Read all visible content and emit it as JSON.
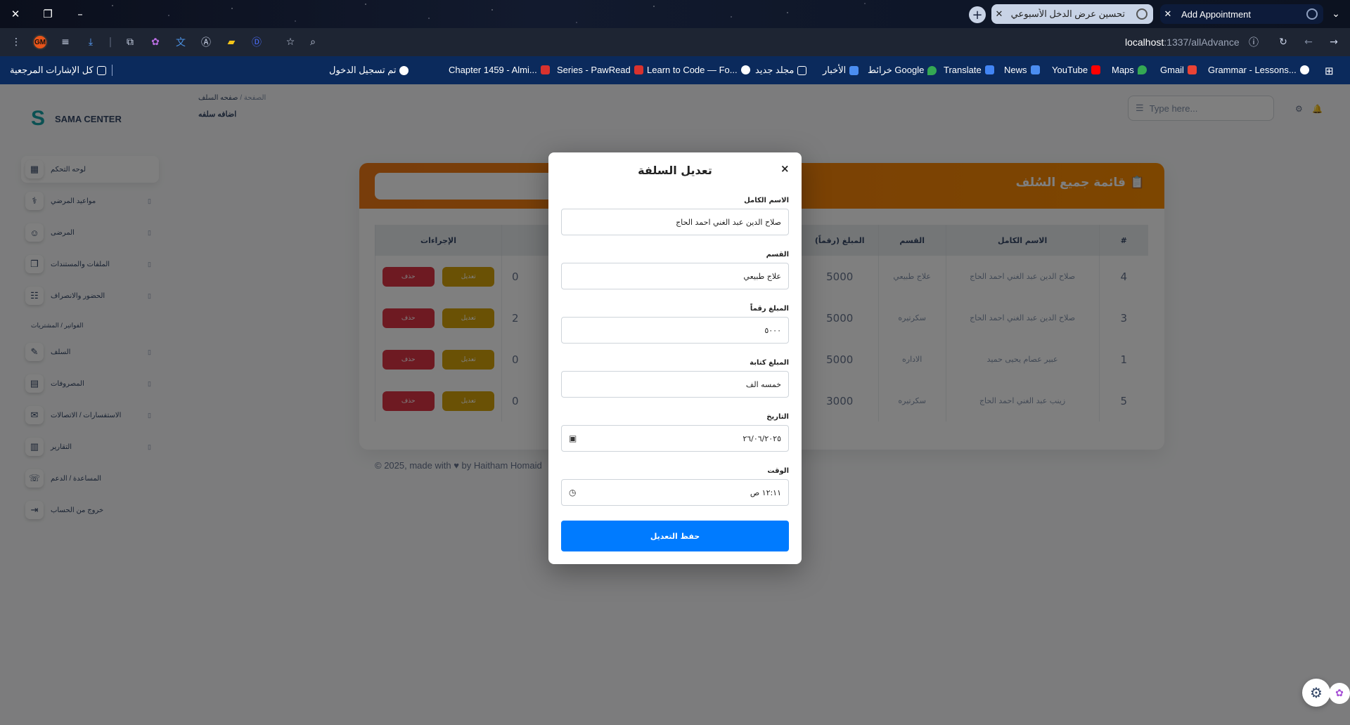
{
  "browser": {
    "tabs": [
      {
        "title": "تحسين عرض الدخل الأسبوعي",
        "active": false
      },
      {
        "title": "Add Appointment",
        "active": true
      }
    ],
    "url_host": "localhost",
    "url_path": ":1337/allAdvance",
    "profile_initials": "GM",
    "bookmarks": [
      {
        "label": "كل الإشارات المرجعية",
        "icon": "folder-icon"
      },
      {
        "label": "تم تسجيل الدخول",
        "icon": "whatsapp-icon"
      },
      {
        "label": "Chapter 1459 - Almi...",
        "icon": "paw-icon"
      },
      {
        "label": "Series - PawRead",
        "icon": "paw-icon"
      },
      {
        "label": "Learn to Code — Fo...",
        "icon": "freecodecamp-icon"
      },
      {
        "label": "مجلد جديد",
        "icon": "folder-icon"
      },
      {
        "label": "الأخبار",
        "icon": "news-icon"
      },
      {
        "label": "Google خرائط",
        "icon": "maps-icon"
      },
      {
        "label": "Translate",
        "icon": "translate-icon"
      },
      {
        "label": "News",
        "icon": "news-icon"
      },
      {
        "label": "YouTube",
        "icon": "youtube-icon"
      },
      {
        "label": "Maps",
        "icon": "maps-icon"
      },
      {
        "label": "Gmail",
        "icon": "gmail-icon"
      },
      {
        "label": "Grammar - Lessons...",
        "icon": "grammar-icon"
      }
    ]
  },
  "app": {
    "brand": "SAMA CENTER",
    "breadcrumb": {
      "home": "الصفحة",
      "current": "صفحه السلف"
    },
    "page_subtitle": "اضافه سلفه",
    "search_placeholder": "Type here...",
    "sidebar": {
      "items": [
        {
          "label": "لوحه التحكم",
          "icon": "dashboard-icon",
          "active": true
        },
        {
          "label": "مواعيد المرضي",
          "icon": "doctor-icon"
        },
        {
          "label": "المرضى",
          "icon": "patients-icon"
        },
        {
          "label": "الملفات والمستندات",
          "icon": "files-icon"
        },
        {
          "label": "الحضور والانصراف",
          "icon": "attendance-icon"
        },
        {
          "label": "السلف",
          "icon": "advance-icon"
        },
        {
          "label": "المصروفات",
          "icon": "expenses-icon"
        },
        {
          "label": "الاستفسارات / الاتصالات",
          "icon": "inquiries-icon"
        },
        {
          "label": "التقارير",
          "icon": "reports-icon"
        },
        {
          "label": "المساعدة / الدعم",
          "icon": "support-icon"
        },
        {
          "label": "خروج من الحساب",
          "icon": "logout-icon"
        }
      ],
      "section_label": "الفواتير / المشتريات"
    },
    "card": {
      "title": "قائمة جميع السُلف",
      "columns": [
        "#",
        "الاسم الكامل",
        "القسم",
        "المبلغ (رقماً)",
        "الإجراءات"
      ],
      "rows": [
        {
          "num": "4",
          "name": "صلاح الدين عبد الغني احمد الحاج",
          "dept": "علاج طبيعي",
          "amount": "5000",
          "partial": "0"
        },
        {
          "num": "3",
          "name": "صلاح الدين عبد الغني احمد الحاج",
          "dept": "سكرتيره",
          "amount": "5000",
          "partial": "2"
        },
        {
          "num": "1",
          "name": "عبير عصام يحيى حميد",
          "dept": "الاداره",
          "amount": "5000",
          "partial": "0"
        },
        {
          "num": "5",
          "name": "زينب عبد الغني احمد الحاج",
          "dept": "سكرتيره",
          "amount": "3000",
          "partial": "0"
        }
      ],
      "edit_label": "تعديل",
      "delete_label": "حذف"
    },
    "footer": "© 2025, made with ♥ by Haitham Homaid"
  },
  "modal": {
    "title": "تعديل السلفة",
    "close": "×",
    "fields": {
      "full_name": {
        "label": "الاسم الكامل",
        "value": "صلاح الدين عبد الغني احمد الحاج"
      },
      "department": {
        "label": "القسم",
        "value": "علاج طبيعي"
      },
      "amount_number": {
        "label": "المبلغ رقماً",
        "value": "٥٠٠٠"
      },
      "amount_words": {
        "label": "المبلغ كتابة",
        "value": "خمسه الف"
      },
      "date": {
        "label": "التاريخ",
        "value": "٢٦/٠٦/٢٠٢٥"
      },
      "time": {
        "label": "الوقت",
        "value": "١٢:١١ ص"
      }
    },
    "save_label": "حفظ التعديل"
  }
}
